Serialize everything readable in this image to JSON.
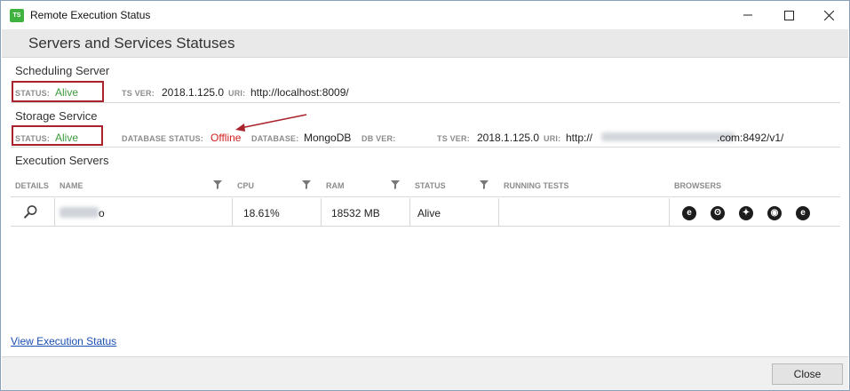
{
  "window": {
    "title": "Remote Execution Status",
    "app_icon_text": "TS"
  },
  "header": {
    "title": "Servers and Services Statuses"
  },
  "scheduling_server": {
    "section_title": "Scheduling Server",
    "status_label": "STATUS:",
    "status_value": "Alive",
    "ts_ver_label": "TS VER:",
    "ts_ver_value": "2018.1.125.0",
    "uri_label": "URI:",
    "uri_value": "http://localhost:8009/"
  },
  "storage_service": {
    "section_title": "Storage Service",
    "status_label": "STATUS:",
    "status_value": "Alive",
    "db_status_label": "DATABASE STATUS:",
    "db_status_value": "Offline",
    "database_label": "DATABASE:",
    "database_value": "MongoDB",
    "db_ver_label": "DB VER:",
    "db_ver_value": "",
    "ts_ver_label": "TS VER:",
    "ts_ver_value": "2018.1.125.0",
    "uri_label": "URI:",
    "uri_prefix": "http://",
    "uri_suffix": ".com:8492/v1/"
  },
  "execution_servers": {
    "section_title": "Execution Servers",
    "columns": [
      "DETAILS",
      "NAME",
      "CPU",
      "RAM",
      "STATUS",
      "RUNNING TESTS",
      "BROWSERS"
    ],
    "rows": [
      {
        "name_suffix": "o",
        "cpu": "18.61%",
        "ram": "18532 MB",
        "status": "Alive",
        "running_tests": "",
        "browsers": [
          "internet-explorer-icon",
          "firefox-icon",
          "safari-icon",
          "chrome-icon",
          "edge-icon"
        ]
      }
    ]
  },
  "footer": {
    "link_label": "View Execution Status",
    "close_label": "Close"
  },
  "colors": {
    "alive": "#3c9a3c",
    "offline": "#d42020",
    "highlight_box": "#a8232b",
    "link": "#1a4fb3"
  }
}
